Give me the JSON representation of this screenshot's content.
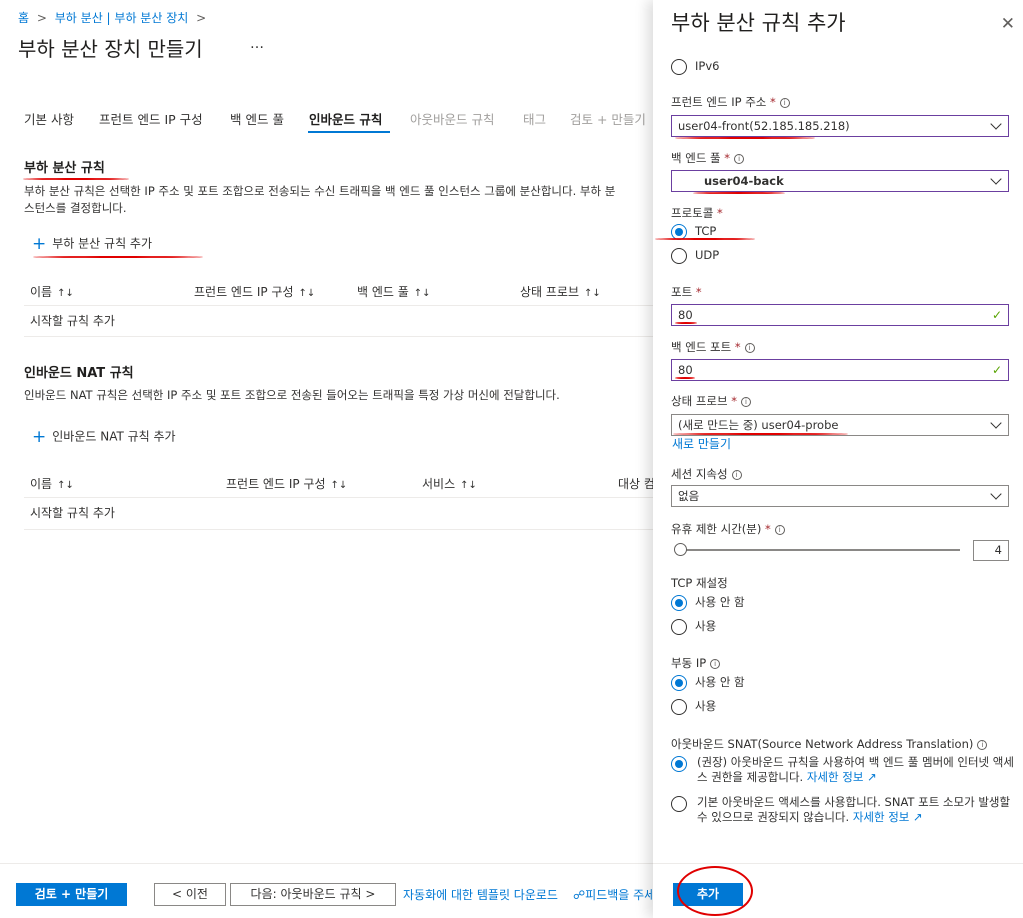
{
  "breadcrumb": {
    "home": "홈",
    "sep": ">",
    "parent": "부하 분산 | 부하 분산 장치"
  },
  "page": {
    "title": "부하 분산 장치 만들기",
    "more": "…"
  },
  "tabs": [
    {
      "label": "기본 사항",
      "state": "normal"
    },
    {
      "label": "프런트 엔드 IP 구성",
      "state": "normal"
    },
    {
      "label": "백 엔드 풀",
      "state": "normal"
    },
    {
      "label": "인바운드 규칙",
      "state": "active"
    },
    {
      "label": "아웃바운드 규칙",
      "state": "disabled"
    },
    {
      "label": "태그",
      "state": "disabled"
    },
    {
      "label": "검토 + 만들기",
      "state": "disabled"
    }
  ],
  "lb_rules": {
    "title": "부하 분산 규칙",
    "desc1": "부하 분산 규칙은 선택한 IP 주소 및 포트 조합으로 전송되는 수신 트래픽을 백 엔드 풀 인스턴스 그룹에 분산합니다. 부하 분",
    "desc2": "스턴스를 결정합니다.",
    "add": "부하 분산 규칙 추가",
    "columns": [
      "이름",
      "프런트 엔드 IP 구성",
      "백 엔드 풀",
      "상태 프로브"
    ],
    "empty": "시작할 규칙 추가"
  },
  "nat_rules": {
    "title": "인바운드 NAT 규칙",
    "desc": "인바운드 NAT 규칙은 선택한 IP 주소 및 포트 조합으로 전송된 들어오는 트래픽을 특정 가상 머신에 전달합니다.",
    "add": "인바운드 NAT 규칙 추가",
    "columns": [
      "이름",
      "프런트 엔드 IP 구성",
      "서비스",
      "대상 컴"
    ],
    "empty": "시작할 규칙 추가"
  },
  "sort_glyph": "↑↓",
  "footer": {
    "review": "검토 + 만들기",
    "prev": "< 이전",
    "next": "다음: 아웃바운드 규칙 >",
    "template": "자동화에 대한 템플릿 다운로드",
    "feedback": "피드백을 주세",
    "add": "추가"
  },
  "panel": {
    "title": "부하 분산 규칙 추가",
    "close": "✕",
    "ipv6": "IPv6",
    "frontend_label": "프런트 엔드 IP 주소",
    "frontend_value": "user04-front(52.185.185.218)",
    "backend_label": "백 엔드 풀",
    "backend_value": "user04-back",
    "protocol_label": "프로토콜",
    "protocol_tcp": "TCP",
    "protocol_udp": "UDP",
    "port_label": "포트",
    "port_value": "80",
    "backend_port_label": "백 엔드 포트",
    "backend_port_value": "80",
    "probe_label": "상태 프로브",
    "probe_value": "(새로 만드는 중) user04-probe",
    "create_new": "새로 만들기",
    "session_label": "세션 지속성",
    "session_value": "없음",
    "idle_label": "유휴 제한 시간(분)",
    "idle_value": "4",
    "tcp_reset_label": "TCP 재설정",
    "floating_label": "부동 IP",
    "opt_disabled": "사용 안 함",
    "opt_enabled": "사용",
    "snat_label": "아웃바운드 SNAT(Source Network Address Translation)",
    "snat_opt1": "(권장) 아웃바운드 규칙을 사용하여 백 엔드 풀 멤버에 인터넷 액세스 권한을 제공합니다.",
    "snat_opt2": "기본 아웃바운드 액세스를 사용합니다. SNAT 포트 소모가 발생할 수 있으므로 권장되지 않습니다.",
    "learn_more": "자세한 정보",
    "required": "*"
  }
}
